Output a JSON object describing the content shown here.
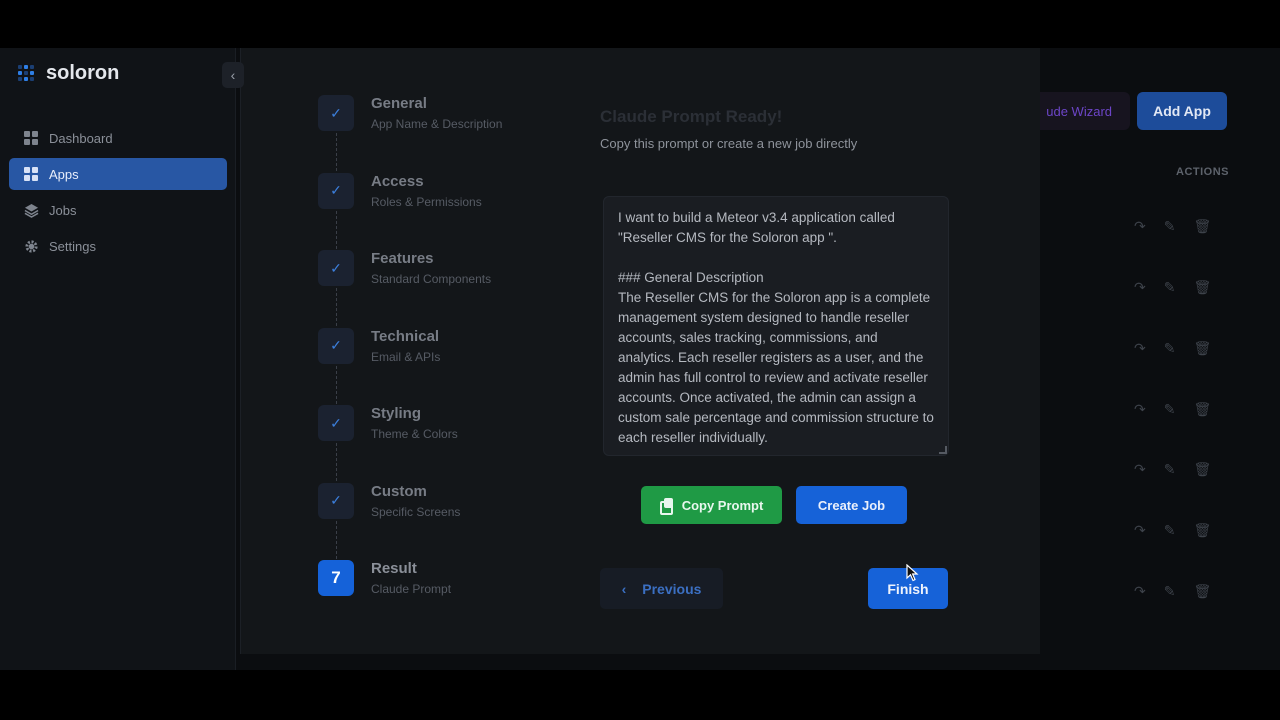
{
  "brand": {
    "name": "soloron"
  },
  "sidebar": {
    "items": [
      {
        "label": "Dashboard",
        "icon": "dashboard-icon",
        "active": false
      },
      {
        "label": "Apps",
        "icon": "apps-icon",
        "active": true
      },
      {
        "label": "Jobs",
        "icon": "layers-icon",
        "active": false
      },
      {
        "label": "Settings",
        "icon": "gear-icon",
        "active": false
      }
    ]
  },
  "background": {
    "wizard_button_label": "ude Wizard",
    "add_app_label": "Add App",
    "actions_header": "ACTIONS"
  },
  "wizard": {
    "steps": [
      {
        "title": "General",
        "subtitle": "App Name & Description",
        "status": "done"
      },
      {
        "title": "Access",
        "subtitle": "Roles & Permissions",
        "status": "done"
      },
      {
        "title": "Features",
        "subtitle": "Standard Components",
        "status": "done"
      },
      {
        "title": "Technical",
        "subtitle": "Email & APIs",
        "status": "done"
      },
      {
        "title": "Styling",
        "subtitle": "Theme & Colors",
        "status": "done"
      },
      {
        "title": "Custom",
        "subtitle": "Specific Screens",
        "status": "done"
      },
      {
        "title": "Result",
        "subtitle": "Claude Prompt",
        "status": "current",
        "number": "7"
      }
    ],
    "result": {
      "title": "Claude Prompt Ready!",
      "subtitle": "Copy this prompt or create a new job directly",
      "prompt_text": "I want to build a Meteor v3.4 application called \"Reseller CMS for the Soloron app \".\n\n### General Description\nThe Reseller CMS for the Soloron app is a complete management system designed to handle reseller accounts, sales tracking, commissions, and analytics. Each reseller registers as a user, and the admin has full control to review and activate reseller accounts. Once activated, the admin can assign a custom sale percentage and commission structure to each reseller individually.",
      "copy_label": "Copy Prompt",
      "create_label": "Create Job"
    },
    "footer": {
      "previous_label": "Previous",
      "finish_label": "Finish"
    }
  },
  "colors": {
    "accent_blue": "#1662d8",
    "success_green": "#1f9a45",
    "sidebar_active": "#2857a4",
    "wizard_purple": "#6c45c7"
  }
}
